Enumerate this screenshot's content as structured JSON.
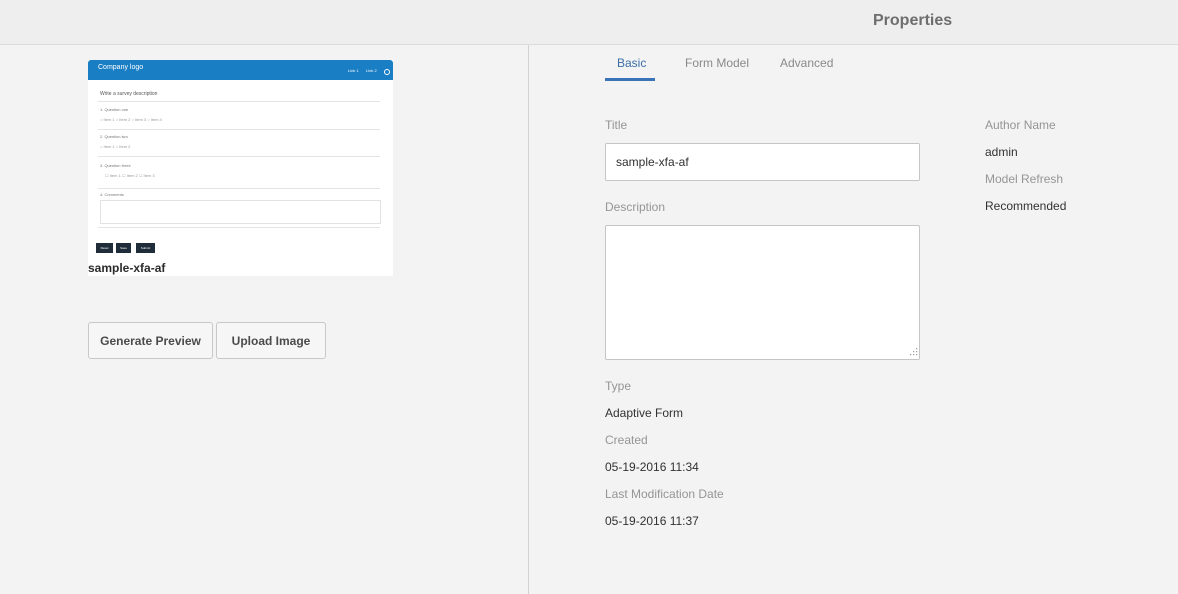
{
  "header": {
    "title": "Properties"
  },
  "thumbnail": {
    "logo_text": "Company logo",
    "links": [
      "Link 1",
      "Link 2"
    ],
    "description": "Write a survey description",
    "questions": [
      {
        "label": "1.  Question one",
        "options": "○ Item 1  ○ Item 2  ○ Item 3  ○ Item 4"
      },
      {
        "label": "2.  Question two",
        "options": "○ Item 1  ○ Item 2"
      },
      {
        "label": "3.  Question three",
        "options": "☐ Item 1    ☐ Item 2    ☐ Item 3"
      },
      {
        "label": "4.  Comments",
        "options": ""
      }
    ],
    "buttons": [
      "Reset",
      "Save",
      "Submit"
    ],
    "name": "sample-xfa-af"
  },
  "actions": {
    "generate_preview": "Generate Preview",
    "upload_image": "Upload Image"
  },
  "tabs": [
    {
      "label": "Basic",
      "active": true
    },
    {
      "label": "Form Model",
      "active": false
    },
    {
      "label": "Advanced",
      "active": false
    }
  ],
  "form": {
    "title_label": "Title",
    "title_value": "sample-xfa-af",
    "description_label": "Description",
    "description_value": "",
    "type_label": "Type",
    "type_value": "Adaptive Form",
    "created_label": "Created",
    "created_value": "05-19-2016 11:34",
    "modified_label": "Last Modification Date",
    "modified_value": "05-19-2016 11:37"
  },
  "side": {
    "author_label": "Author Name",
    "author_value": "admin",
    "refresh_label": "Model Refresh",
    "refresh_value": "Recommended"
  },
  "colors": {
    "accent": "#3b73b9",
    "thumbnail_bar": "#1a7ec4"
  }
}
